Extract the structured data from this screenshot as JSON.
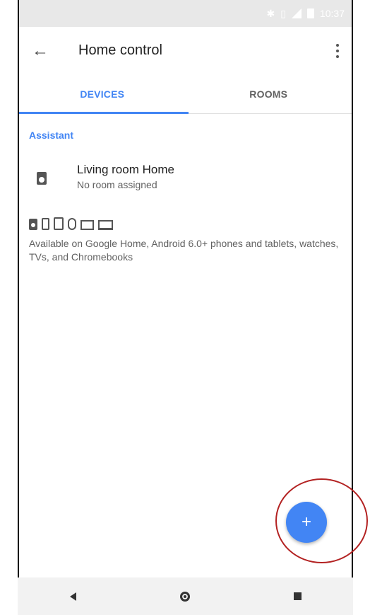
{
  "status_bar": {
    "time": "10:37",
    "icons": [
      "bluetooth-icon",
      "vibrate-icon",
      "lte-signal-icon",
      "battery-icon"
    ]
  },
  "app_bar": {
    "title": "Home control",
    "back_icon": "arrow-left-icon",
    "menu_icon": "more-vert-icon"
  },
  "tabs": [
    {
      "label": "DEVICES",
      "active": true
    },
    {
      "label": "ROOMS",
      "active": false
    }
  ],
  "section": {
    "header": "Assistant"
  },
  "device": {
    "name": "Living room Home",
    "room": "No room assigned",
    "icon": "speaker-icon"
  },
  "device_types_icons": [
    "speaker-icon",
    "phone-icon",
    "tablet-icon",
    "watch-icon",
    "tv-icon",
    "laptop-icon"
  ],
  "availability_text": "Available on Google Home, Android 6.0+ phones and tablets, watches, TVs, and Chromebooks",
  "fab": {
    "label": "+",
    "color": "#4285f4"
  },
  "colors": {
    "accent": "#4285f4",
    "highlight_ring": "#b32222"
  },
  "nav_bar": {
    "icons": [
      "nav-back-icon",
      "nav-home-icon",
      "nav-recents-icon"
    ]
  }
}
